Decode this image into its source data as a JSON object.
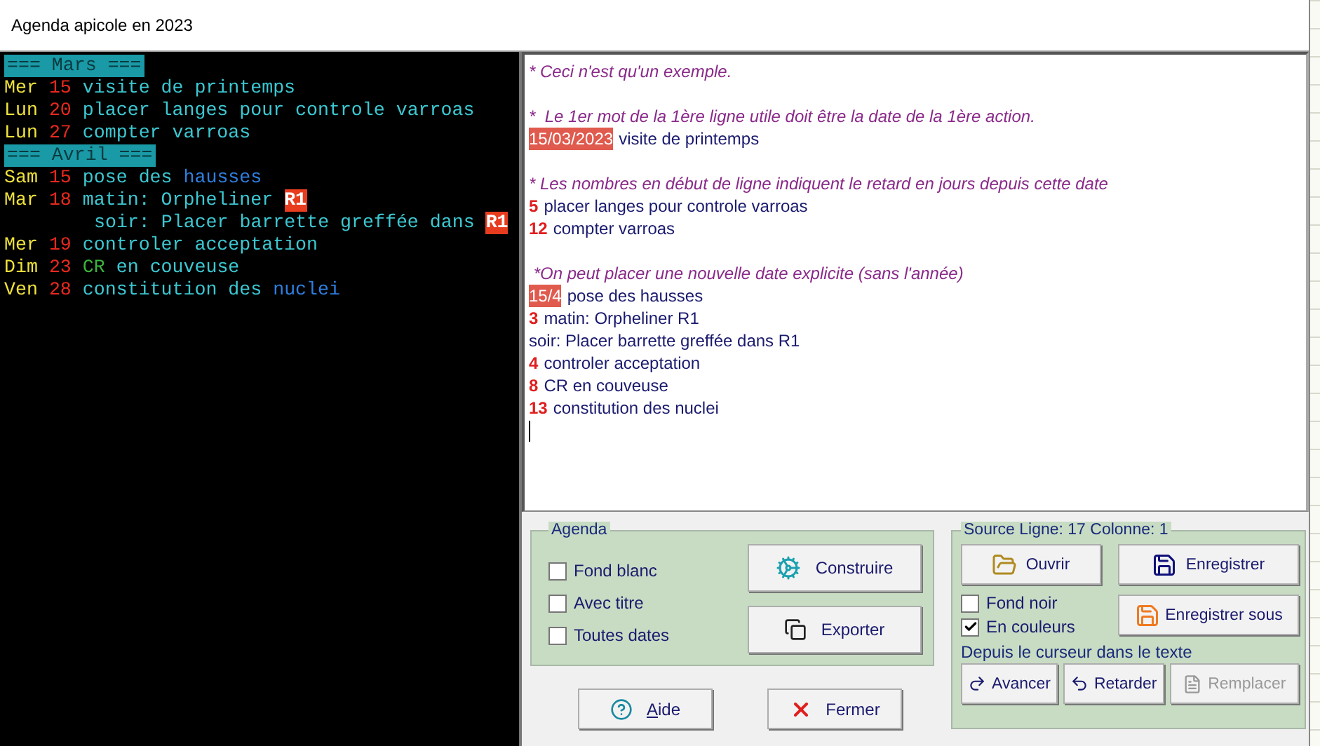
{
  "window": {
    "title": "Agenda apicole en 2023"
  },
  "agenda_preview": {
    "lines": [
      {
        "kind": "header",
        "text": "=== Mars ==="
      },
      {
        "kind": "entry",
        "day": "Mer",
        "num": "15",
        "segments": [
          {
            "text": "visite de printemps",
            "kind": "normal"
          }
        ]
      },
      {
        "kind": "entry",
        "day": "Lun",
        "num": "20",
        "segments": [
          {
            "text": "placer langes pour controle varroas",
            "kind": "normal"
          }
        ]
      },
      {
        "kind": "entry",
        "day": "Lun",
        "num": "27",
        "segments": [
          {
            "text": "compter varroas",
            "kind": "normal"
          }
        ]
      },
      {
        "kind": "header",
        "text": "=== Avril ==="
      },
      {
        "kind": "entry",
        "day": "Sam",
        "num": "15",
        "segments": [
          {
            "text": "pose des",
            "kind": "normal"
          },
          {
            "text": "hausses",
            "kind": "blue"
          }
        ]
      },
      {
        "kind": "entry",
        "day": "Mar",
        "num": "18",
        "segments": [
          {
            "text": "matin: Orpheliner",
            "kind": "normal"
          },
          {
            "text": "R1",
            "kind": "tag"
          }
        ]
      },
      {
        "kind": "entry",
        "segments": [
          {
            "text": "soir: Placer barrette greffée dans",
            "kind": "normal"
          },
          {
            "text": "R1",
            "kind": "tag"
          }
        ]
      },
      {
        "kind": "entry",
        "day": "Mer",
        "num": "19",
        "segments": [
          {
            "text": "controler acceptation",
            "kind": "normal"
          }
        ]
      },
      {
        "kind": "entry",
        "day": "Dim",
        "num": "23",
        "segments": [
          {
            "text": "CR",
            "kind": "green"
          },
          {
            "text": "en couveuse",
            "kind": "normal"
          }
        ]
      },
      {
        "kind": "entry",
        "day": "Ven",
        "num": "28",
        "segments": [
          {
            "text": "constitution des",
            "kind": "normal"
          },
          {
            "text": "nuclei",
            "kind": "blue"
          }
        ]
      }
    ]
  },
  "source_editor": {
    "lines": [
      {
        "kind": "comment",
        "text": "* Ceci n'est qu'un exemple."
      },
      {
        "kind": "blank"
      },
      {
        "kind": "comment",
        "text": "*  Le 1er mot de la 1ère ligne utile doit être la date de la 1ère action."
      },
      {
        "kind": "date",
        "lead": "15/03/2023",
        "text": "visite de printemps"
      },
      {
        "kind": "blank"
      },
      {
        "kind": "comment",
        "text": "* Les nombres en début de ligne indiquent le retard en jours depuis cette date"
      },
      {
        "kind": "delay",
        "lead": "5",
        "text": "placer langes pour controle varroas"
      },
      {
        "kind": "delay",
        "lead": "12",
        "text": "compter varroas"
      },
      {
        "kind": "blank"
      },
      {
        "kind": "comment",
        "text": " *On peut placer une nouvelle date explicite (sans l'année)"
      },
      {
        "kind": "date",
        "lead": "15/4",
        "text": "pose des hausses"
      },
      {
        "kind": "delay",
        "lead": "3",
        "text": "matin: Orpheliner R1"
      },
      {
        "kind": "plain",
        "text": "soir: Placer barrette greffée dans R1"
      },
      {
        "kind": "delay",
        "lead": "4",
        "text": "controler acceptation"
      },
      {
        "kind": "delay",
        "lead": "8",
        "text": "CR en couveuse"
      },
      {
        "kind": "delay",
        "lead": "13",
        "text": "constitution des nuclei"
      },
      {
        "kind": "cursor"
      }
    ]
  },
  "agenda_group": {
    "title": "Agenda",
    "checkboxes": [
      {
        "label": "Fond blanc",
        "checked": false
      },
      {
        "label": "Avec titre",
        "checked": false
      },
      {
        "label": "Toutes dates",
        "checked": false
      }
    ],
    "buttons": [
      {
        "label": "Construire"
      },
      {
        "label": "Exporter"
      }
    ]
  },
  "dialog_buttons": [
    {
      "label": "Aide",
      "mnemonic": true
    },
    {
      "label": "Fermer",
      "mnemonic": false
    }
  ],
  "source_group": {
    "title": "Source Ligne: 17  Colonne: 1",
    "buttons": [
      {
        "label": "Ouvrir"
      },
      {
        "label": "Enregistrer"
      }
    ],
    "checkboxes": [
      {
        "label": "Fond noir",
        "checked": false
      },
      {
        "label": "En couleurs",
        "checked": true
      }
    ],
    "save_as": {
      "label": "Enregistrer sous"
    },
    "cursor_label": "Depuis le curseur dans le texte",
    "cursor_buttons": [
      {
        "label": "Avancer",
        "disabled": false
      },
      {
        "label": "Retarder",
        "disabled": false
      },
      {
        "label": "Remplacer",
        "disabled": true
      }
    ]
  }
}
